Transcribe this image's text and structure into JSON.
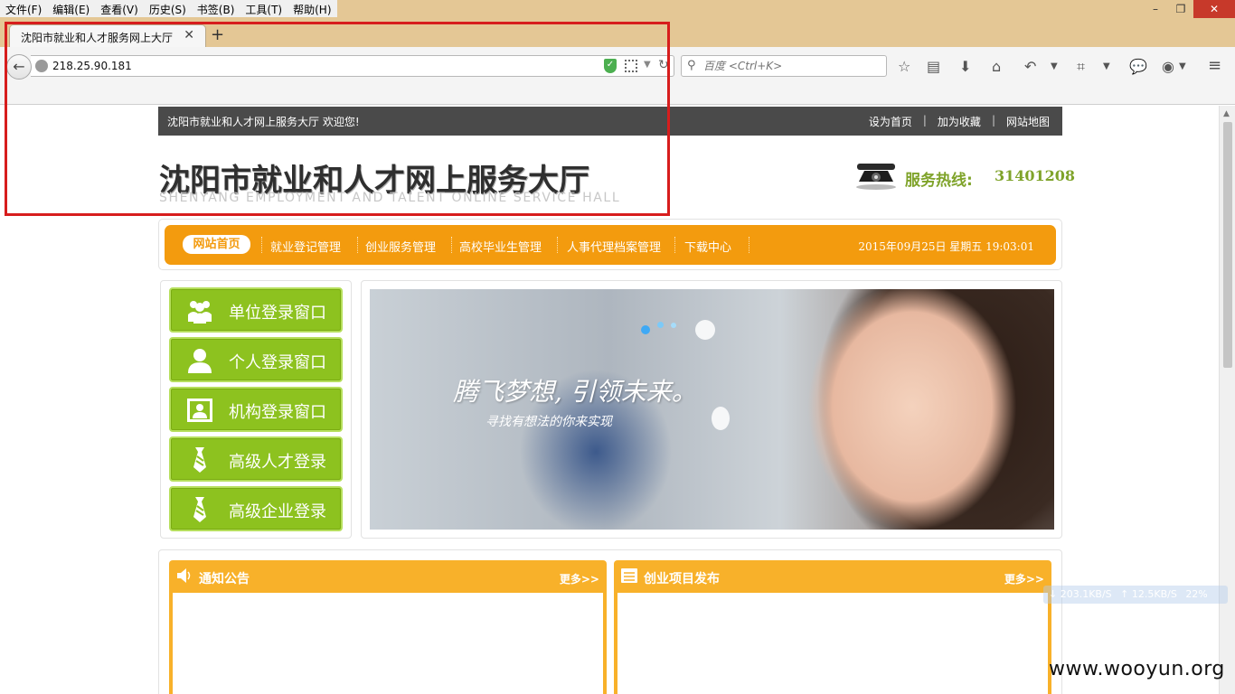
{
  "menubar": {
    "items": [
      "文件(F)",
      "编辑(E)",
      "查看(V)",
      "历史(S)",
      "书签(B)",
      "工具(T)",
      "帮助(H)"
    ]
  },
  "window_controls": {
    "minimize": "–",
    "restore": "❐",
    "close": "✕"
  },
  "tab": {
    "title": "沈阳市就业和人才服务网上大厅",
    "close": "✕",
    "new_tab": "+"
  },
  "address_bar": {
    "url": "218.25.90.181"
  },
  "search": {
    "placeholder": "百度 <Ctrl+K>"
  },
  "toolbar_icons": [
    "star-icon",
    "reading-list-icon",
    "download-icon",
    "home-icon",
    "undo-icon",
    "crop-icon",
    "chat-icon",
    "extension-icon",
    "menu-icon"
  ],
  "site": {
    "top_strip": {
      "welcome": "沈阳市就业和人才网上服务大厅 欢迎您!",
      "links": [
        "设为首页",
        "加为收藏",
        "网站地图"
      ],
      "separator": "|"
    },
    "logo": {
      "cn": "沈阳市就业和人才网上服务大厅",
      "en": "SHENYANG EMPLOYMENT AND TALENT ONLINE SERVICE HALL"
    },
    "hotline": {
      "label": "服务热线:",
      "number": "31401208"
    },
    "nav": {
      "home": "网站首页",
      "items": [
        "就业登记管理",
        "创业服务管理",
        "高校毕业生管理",
        "人事代理档案管理",
        "下载中心"
      ],
      "datetime": "2015年09月25日 星期五 19:03:01"
    },
    "login_buttons": [
      {
        "label": "单位登录窗口",
        "icon": "group-icon"
      },
      {
        "label": "个人登录窗口",
        "icon": "person-icon"
      },
      {
        "label": "机构登录窗口",
        "icon": "id-card-icon"
      },
      {
        "label": "高级人才登录",
        "icon": "tie-icon"
      },
      {
        "label": "高级企业登录",
        "icon": "tie-icon"
      }
    ],
    "banner": {
      "slogan": "腾飞梦想, 引领未来。",
      "sub": "寻找有想法的你来实现"
    },
    "panels": [
      {
        "title": "通知公告",
        "more": "更多>>",
        "icon": "speaker-icon"
      },
      {
        "title": "创业项目发布",
        "more": "更多>>",
        "icon": "list-icon"
      }
    ]
  },
  "net_monitor": {
    "down": "↓ 203.1KB/S",
    "up": "↑ 12.5KB/S",
    "cpu": "22%"
  },
  "watermark": "www.wooyun.org",
  "colors": {
    "nav_orange": "#f39b0e",
    "login_green": "#8dc21f",
    "panel_orange": "#f8b12a",
    "annotation_red": "#d71d1d"
  }
}
